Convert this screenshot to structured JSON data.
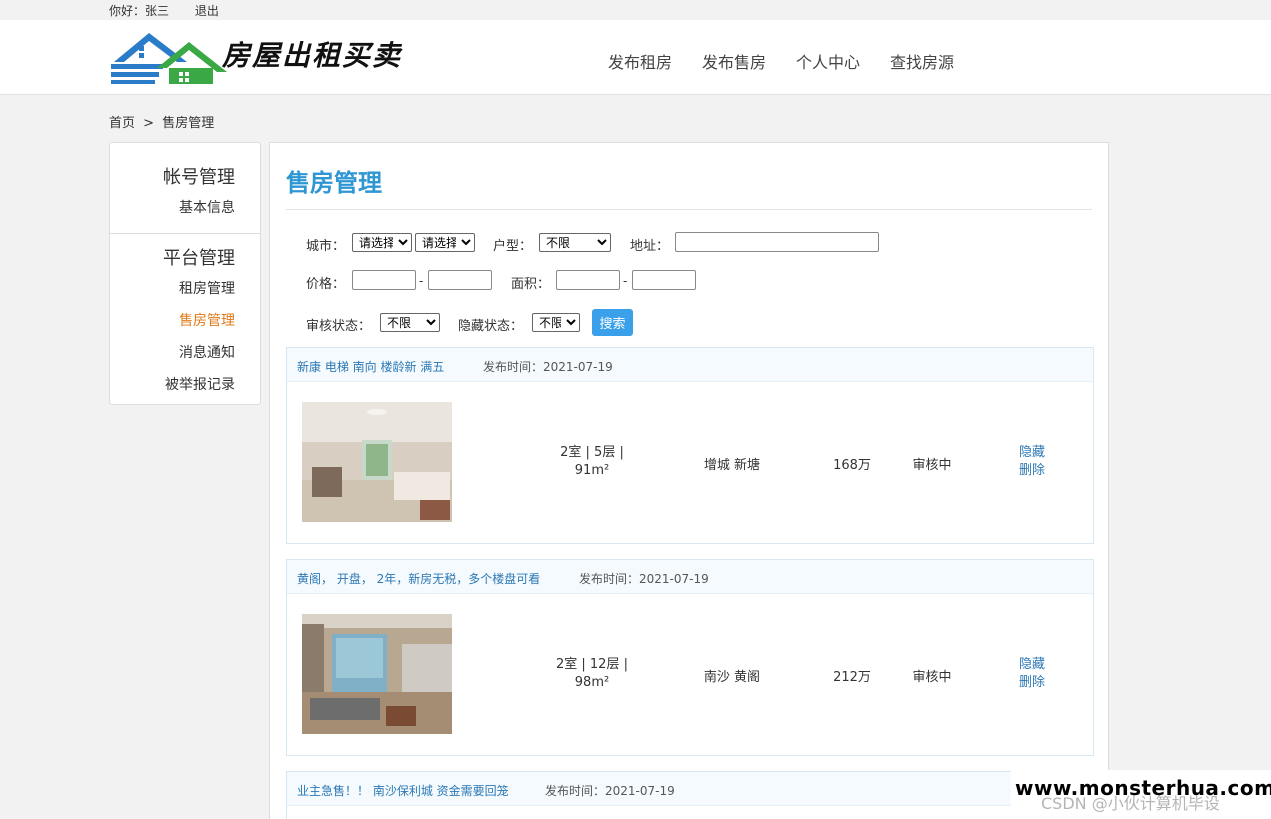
{
  "topbar": {
    "greeting": "你好：",
    "username": "张三",
    "logout": "退出"
  },
  "header": {
    "site_title": "房屋出租买卖",
    "nav": [
      "发布租房",
      "发布售房",
      "个人中心",
      "查找房源"
    ]
  },
  "breadcrumb": {
    "home": "首页",
    "sep": ">",
    "current": "售房管理"
  },
  "sidebar": {
    "group1": {
      "title": "帐号管理",
      "items": [
        "基本信息"
      ]
    },
    "group2": {
      "title": "平台管理",
      "items": [
        "租房管理",
        "售房管理",
        "消息通知",
        "被举报记录"
      ]
    },
    "active": "售房管理"
  },
  "main": {
    "title": "售房管理",
    "filters": {
      "city_label": "城市：",
      "city_select1": "请选择",
      "city_select2": "请选择",
      "layout_label": "户型：",
      "layout_value": "不限",
      "address_label": "地址：",
      "address_value": "",
      "price_label": "价格：",
      "price_sep": "-",
      "area_label": "面积：",
      "area_sep": "-",
      "audit_label": "审核状态：",
      "audit_value": "不限",
      "hidden_label": "隐藏状态：",
      "hidden_value": "不限",
      "search_button": "搜索"
    },
    "listings": [
      {
        "title": "新康 电梯 南向 楼龄新 满五",
        "date_label": "发布时间：",
        "date": "2021-07-19",
        "info_line1": "2室 | 5层 |",
        "info_line2": "91m²",
        "location": "增城 新塘",
        "price": "168万",
        "status": "审核中",
        "action_hide": "隐藏",
        "action_delete": "删除"
      },
      {
        "title": "黄阁， 开盘， 2年，新房无税，多个楼盘可看",
        "date_label": "发布时间：",
        "date": "2021-07-19",
        "info_line1": "2室 | 12层 |",
        "info_line2": "98m²",
        "location": "南沙 黄阁",
        "price": "212万",
        "status": "审核中",
        "action_hide": "隐藏",
        "action_delete": "删除"
      },
      {
        "title": "业主急售！！ 南沙保利城 资金需要回笼",
        "date_label": "发布时间：",
        "date": "2021-07-19"
      }
    ]
  },
  "watermark": {
    "line1": "www.monsterhua.com",
    "line2": "CSDN @小伙计算机毕设"
  },
  "colors": {
    "accent": "#2f96d4",
    "active_nav": "#e07a1a",
    "link": "#2c78b5",
    "button": "#3aa0ea"
  }
}
